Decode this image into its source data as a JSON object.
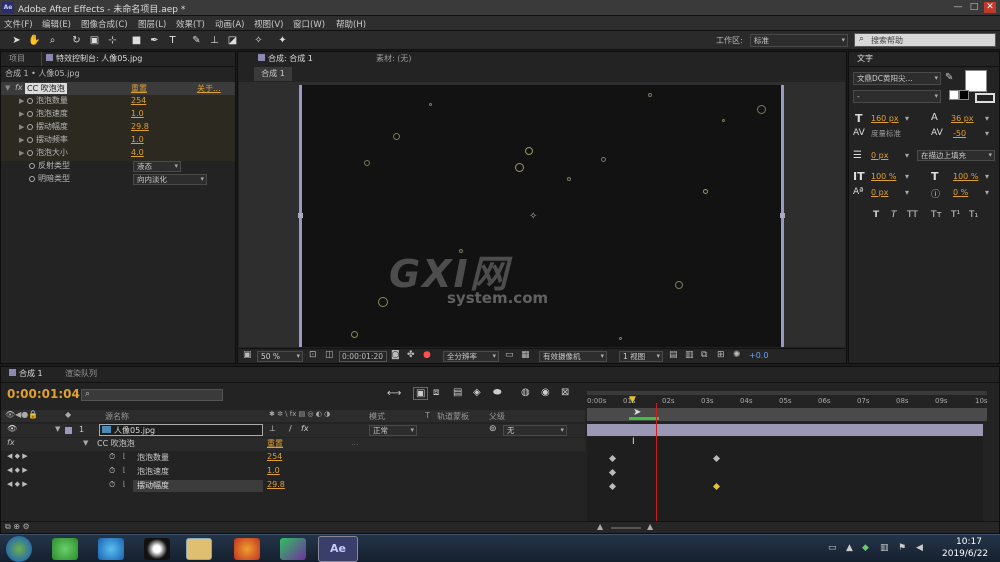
{
  "title": {
    "logo": "Ae",
    "text": "Adobe After Effects - 未命名项目.aep *"
  },
  "window_controls": {
    "min": "—",
    "max": "□",
    "close": "✕"
  },
  "menu": [
    "文件(F)",
    "编辑(E)",
    "图像合成(C)",
    "图层(L)",
    "效果(T)",
    "动画(A)",
    "视图(V)",
    "窗口(W)",
    "帮助(H)"
  ],
  "toolbar": {
    "workspace_label": "工作区:",
    "workspace_value": "标准",
    "search_placeholder": "搜索帮助"
  },
  "tools": [
    "select-tool",
    "hand-tool",
    "zoom-tool",
    "rotate-tool",
    "camera-tool",
    "pan-tool",
    "rect-tool",
    "pen-tool",
    "text-tool",
    "brush-tool",
    "clone-tool",
    "eraser-tool",
    "roto-tool",
    "puppet-tool"
  ],
  "left_panel": {
    "tab_project": "项目",
    "tab_effects": "特效控制台: 人像05.jpg",
    "breadcrumb": "合成 1 • 人像05.jpg",
    "effect_name": "CC 吹泡泡",
    "reset": "重置",
    "about": "关于...",
    "fx": "fx",
    "props": [
      {
        "label": "泡泡数量",
        "value": "254"
      },
      {
        "label": "泡泡速度",
        "value": "1.0"
      },
      {
        "label": "摆动幅度",
        "value": "29.8"
      },
      {
        "label": "摆动频率",
        "value": "1.0"
      },
      {
        "label": "泡泡大小",
        "value": "4.0"
      }
    ],
    "reflection": {
      "label": "反射类型",
      "value": "液态"
    },
    "shading": {
      "label": "明暗类型",
      "value": "向内淡化"
    }
  },
  "center_panel": {
    "tab_comp": "合成: 合成 1",
    "tab_footage": "素材: (无)",
    "comp_chip": "合成 1",
    "watermark_big": "GXI网",
    "watermark_small": "system.com",
    "zoom": "50 %",
    "timecode": "0:00:01:20",
    "resolution": "全分辨率",
    "camera": "有效摄像机",
    "view": "1 视图",
    "exposure": "+0.0"
  },
  "right_panel": {
    "tab": "文字",
    "font_name": "文鼎DC黄阳尖...",
    "font_style": "-",
    "size": "160 px",
    "leading": "36 px",
    "kerning": "度量标准",
    "tracking": "-50",
    "stroke_width": "0 px",
    "stroke_type": "在描边上填充",
    "vscale": "100 %",
    "hscale": "100 %",
    "baseline": "0 px",
    "tsume": "0 %",
    "styles": [
      "T",
      "T",
      "TT",
      "Tт",
      "T¹",
      "T₁"
    ]
  },
  "timeline": {
    "tab_comp": "合成 1",
    "tab_render": "渲染队列",
    "timecode": "0:00:01:04",
    "col_source": "源名称",
    "col_mode": "模式",
    "col_t": "T",
    "col_trkmat": "轨道蒙板",
    "col_parent": "父级",
    "layer_num": "1",
    "layer_name": "人像05.jpg",
    "layer_mode": "正常",
    "layer_parent": "无",
    "effect": "CC 吹泡泡",
    "effect_reset": "重置",
    "fx": "fx",
    "props": [
      {
        "label": "泡泡数量",
        "value": "254"
      },
      {
        "label": "泡泡速度",
        "value": "1.0"
      },
      {
        "label": "摆动幅度",
        "value": "29.8"
      }
    ],
    "ruler": [
      "0:00s",
      "01s",
      "02s",
      "03s",
      "04s",
      "05s",
      "06s",
      "07s",
      "08s",
      "09s",
      "10s"
    ]
  },
  "taskbar": {
    "time": "10:17",
    "date": "2019/6/22",
    "ae": "Ae"
  },
  "colors": {
    "accent": "#e0a030",
    "playhead": "#cc2020",
    "layer_bar": "#9a98b4",
    "keyframe_selected": "#e8c030"
  }
}
